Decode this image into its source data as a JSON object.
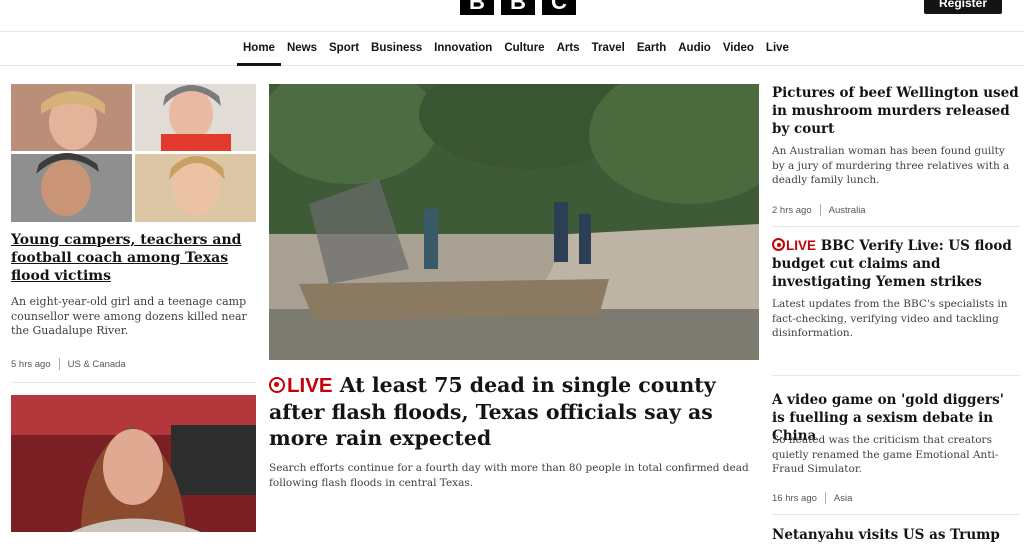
{
  "header": {
    "logo_letters": [
      "B",
      "B",
      "C"
    ],
    "register_label": "Register"
  },
  "nav": {
    "items": [
      "Home",
      "News",
      "Sport",
      "Business",
      "Innovation",
      "Culture",
      "Arts",
      "Travel",
      "Earth",
      "Audio",
      "Video",
      "Live"
    ],
    "active": "Home"
  },
  "left_story": {
    "headline": "Young campers, teachers and football coach among Texas flood victims",
    "summary": "An eight-year-old girl and a teenage camp counsellor were among dozens killed near the Guadalupe River.",
    "time": "5 hrs ago",
    "section": "US & Canada"
  },
  "center_story": {
    "live_label": "LIVE",
    "headline": "At least 75 dead in single county after flash floods, Texas officials say as more rain expected",
    "summary": "Search efforts continue for a fourth day with more than 80 people in total confirmed dead following flash floods in central Texas."
  },
  "right_stories": [
    {
      "headline": "Pictures of beef Wellington used in mushroom murders released by court",
      "summary": "An Australian woman has been found guilty by a jury of murdering three relatives with a deadly family lunch.",
      "time": "2 hrs ago",
      "section": "Australia"
    },
    {
      "live_label": "LIVE",
      "headline": "BBC Verify Live: US flood budget cut claims and investigating Yemen strikes",
      "summary": "Latest updates from the BBC's specialists in fact-checking, verifying video and tackling disinformation."
    },
    {
      "headline": "A video game on 'gold diggers' is fuelling a sexism debate in China",
      "summary": "So heated was the criticism that creators quietly renamed the game Emotional Anti-Fraud Simulator.",
      "time": "16 hrs ago",
      "section": "Asia"
    },
    {
      "headline": "Netanyahu visits US as Trump puts"
    }
  ],
  "colors": {
    "live_red": "#c4000a",
    "text": "#141414",
    "summary_text": "#3f3f42",
    "meta_text": "#545658",
    "divider": "#e6e6e6"
  },
  "images": [
    "flood-victims-collage",
    "airboat-rescue-photo",
    "tearful-woman-photo"
  ]
}
